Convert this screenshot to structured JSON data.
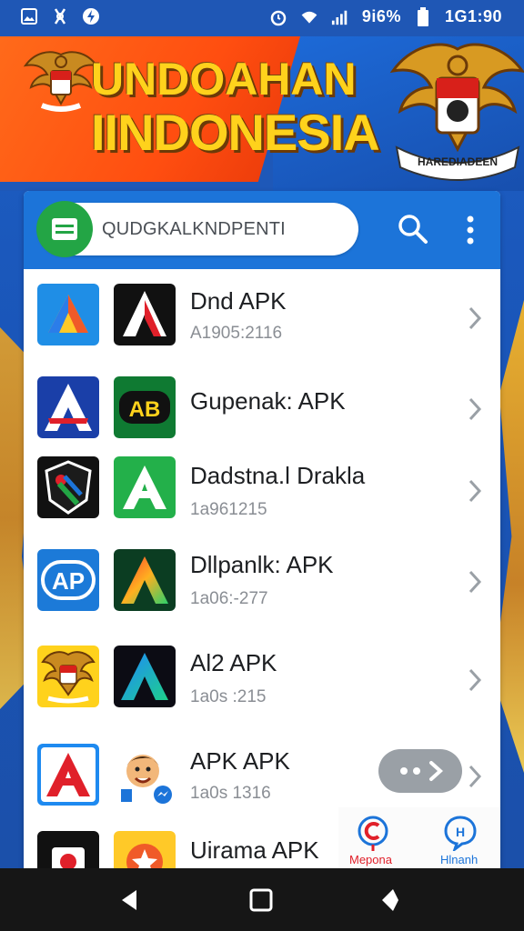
{
  "status_bar": {
    "battery_text": "9i6%",
    "time": "1G1:90",
    "icons": [
      "image-icon",
      "usb-icon",
      "data-icon",
      "alarm-icon",
      "wifi-icon",
      "signal-icon",
      "battery-icon"
    ]
  },
  "banner": {
    "title_line1": "UNDOAHAN",
    "title_line2": "IINDONESIA",
    "emblem_ribbon_text": "HAREDIADEEN"
  },
  "header": {
    "search_text": "QUDGKALKNDPENTI",
    "icons": [
      "menu-icon",
      "search-icon",
      "more-vertical-icon"
    ],
    "accent": "#1c74d9",
    "badge_color": "#23a545"
  },
  "apps": [
    {
      "title": "Dnd APK",
      "subtitle": "A1905:2116",
      "icons": [
        "triangle-logo-icon",
        "red-a-icon"
      ]
    },
    {
      "title": "Gupenak: APK",
      "subtitle": "",
      "icons": [
        "white-a-icon",
        "ab-green-icon"
      ]
    },
    {
      "title": "Dadstna.l Drakla",
      "subtitle": "1a961215",
      "icons": [
        "shield-logo-icon",
        "green-a-icon"
      ]
    },
    {
      "title": "Dllpanlk: APK",
      "subtitle": "1a06:-277",
      "icons": [
        "ap-logo-icon",
        "gradient-a-icon"
      ]
    },
    {
      "title": "Al2 APK",
      "subtitle": "1a0s :215",
      "icons": [
        "garuda-icon",
        "blue-a-icon"
      ]
    },
    {
      "title": "APK APK",
      "subtitle": "1a0s 1316",
      "icons": [
        "red-a-icon",
        "cartoon-avatar-icon"
      ]
    },
    {
      "title": "Uirama APK",
      "subtitle": "",
      "icons": [
        "camera-icon",
        "star-icon"
      ]
    }
  ],
  "bottom_tabs": {
    "left_label": "Mepona",
    "right_label": "Hlnanh"
  },
  "nav_bar": {
    "icons": [
      "back-icon",
      "home-icon",
      "recents-icon"
    ]
  }
}
